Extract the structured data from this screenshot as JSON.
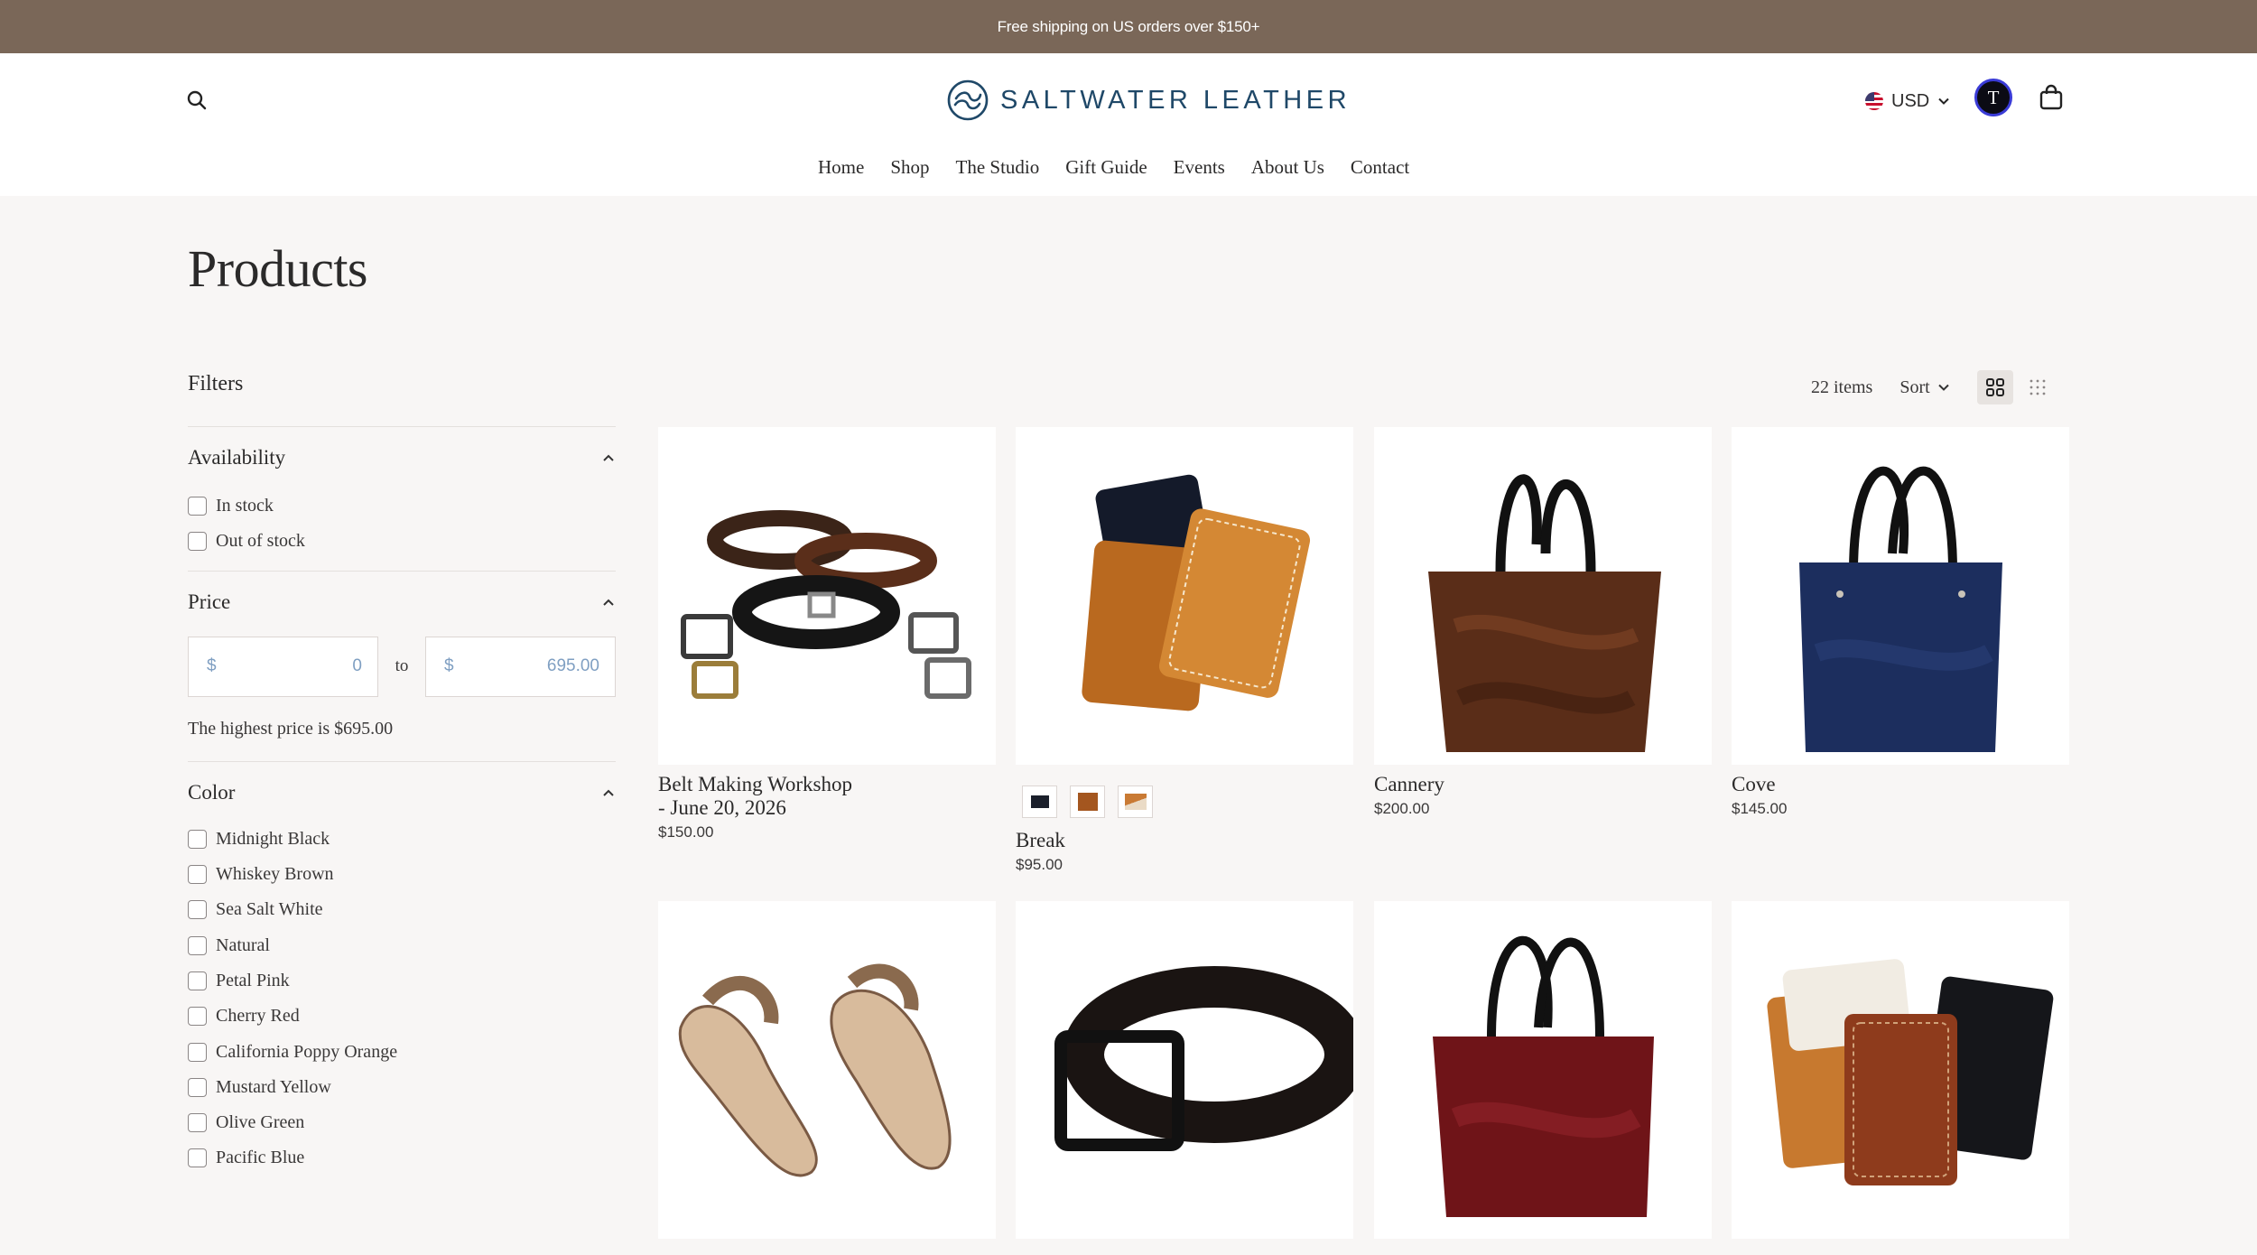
{
  "announcement": {
    "text": "Free shipping on US orders over $150+"
  },
  "brand": {
    "name": "SALTWATER LEATHER",
    "color": "#1f4868"
  },
  "header": {
    "currency": "USD",
    "avatar_initial": "T",
    "nav": [
      "Home",
      "Shop",
      "The Studio",
      "Gift Guide",
      "Events",
      "About Us",
      "Contact"
    ]
  },
  "page": {
    "title": "Products"
  },
  "filters": {
    "title": "Filters",
    "availability": {
      "label": "Availability",
      "options": [
        "In stock",
        "Out of stock"
      ]
    },
    "price": {
      "label": "Price",
      "currency_symbol": "$",
      "min_value": "0",
      "max_value": "695.00",
      "to_label": "to",
      "note": "The highest price is $695.00"
    },
    "color": {
      "label": "Color",
      "options": [
        "Midnight Black",
        "Whiskey Brown",
        "Sea Salt White",
        "Natural",
        "Petal Pink",
        "Cherry Red",
        "California Poppy Orange",
        "Mustard Yellow",
        "Olive Green",
        "Pacific Blue"
      ]
    }
  },
  "toolbar": {
    "items_count": "22 items",
    "sort_label": "Sort"
  },
  "products": [
    {
      "name": "Belt Making Workshop\n- June 20, 2026",
      "price": "$150.00"
    },
    {
      "name": "Break",
      "price": "$95.00"
    },
    {
      "name": "Cannery",
      "price": "$200.00"
    },
    {
      "name": "Cove",
      "price": "$145.00"
    }
  ],
  "colors": {
    "announcement_bg": "#7a6758",
    "page_bg": "#f8f6f5",
    "accent_text": "#1f4868",
    "price_input_text": "#7f9fc2"
  }
}
